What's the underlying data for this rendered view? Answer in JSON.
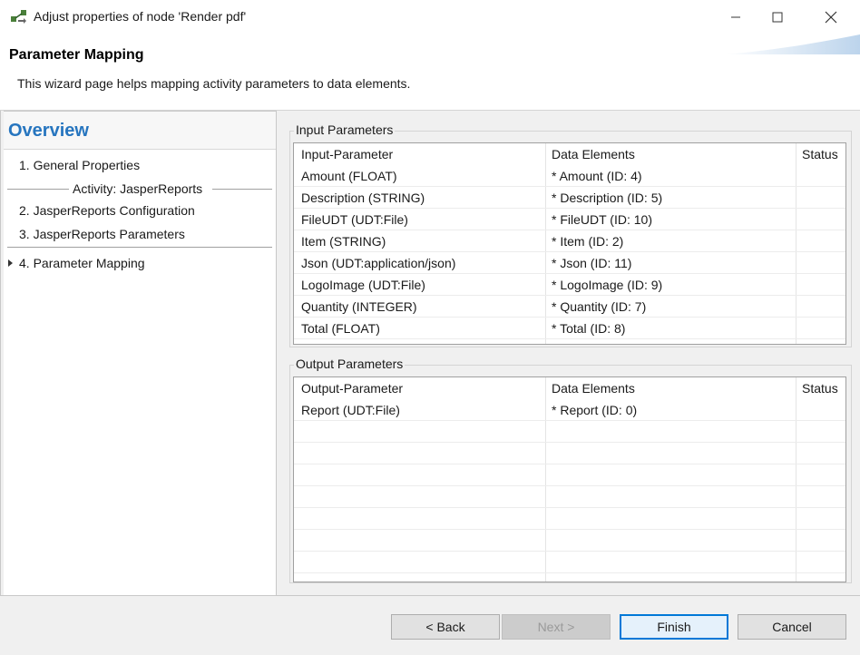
{
  "window": {
    "title": "Adjust properties of node 'Render pdf'"
  },
  "header": {
    "title": "Parameter Mapping",
    "description": "This wizard page helps mapping activity parameters to data elements."
  },
  "nav": {
    "title": "Overview",
    "items": [
      "1. General Properties",
      "2. JasperReports Configuration",
      "3. JasperReports Parameters",
      "4. Parameter Mapping"
    ],
    "subsection": "Activity: JasperReports"
  },
  "input": {
    "label": "Input Parameters",
    "headers": [
      "Input-Parameter",
      "Data Elements",
      "Status"
    ],
    "rows": [
      [
        "Amount  (FLOAT)",
        "* Amount  (ID: 4)"
      ],
      [
        "Description  (STRING)",
        "* Description  (ID: 5)"
      ],
      [
        "FileUDT  (UDT:File)",
        "* FileUDT  (ID: 10)"
      ],
      [
        "Item  (STRING)",
        "* Item  (ID: 2)"
      ],
      [
        "Json  (UDT:application/json)",
        "* Json  (ID: 11)"
      ],
      [
        "LogoImage  (UDT:File)",
        "* LogoImage  (ID: 9)"
      ],
      [
        "Quantity  (INTEGER)",
        "* Quantity  (ID: 7)"
      ],
      [
        "Total  (FLOAT)",
        "* Total  (ID: 8)"
      ]
    ]
  },
  "output": {
    "label": "Output Parameters",
    "headers": [
      "Output-Parameter",
      "Data Elements",
      "Status"
    ],
    "rows": [
      [
        "Report  (UDT:File)",
        "* Report  (ID: 0)"
      ]
    ]
  },
  "buttons": {
    "back": "< Back",
    "next": "Next >",
    "finish": "Finish",
    "cancel": "Cancel"
  },
  "colors": {
    "accent": "#2675bf",
    "focus_border": "#0078d7"
  },
  "icons": {
    "app": "node-graph-icon",
    "minimize": "minimize-icon",
    "maximize": "maximize-icon",
    "close": "close-icon",
    "nav_current": "triangle-right-icon"
  }
}
